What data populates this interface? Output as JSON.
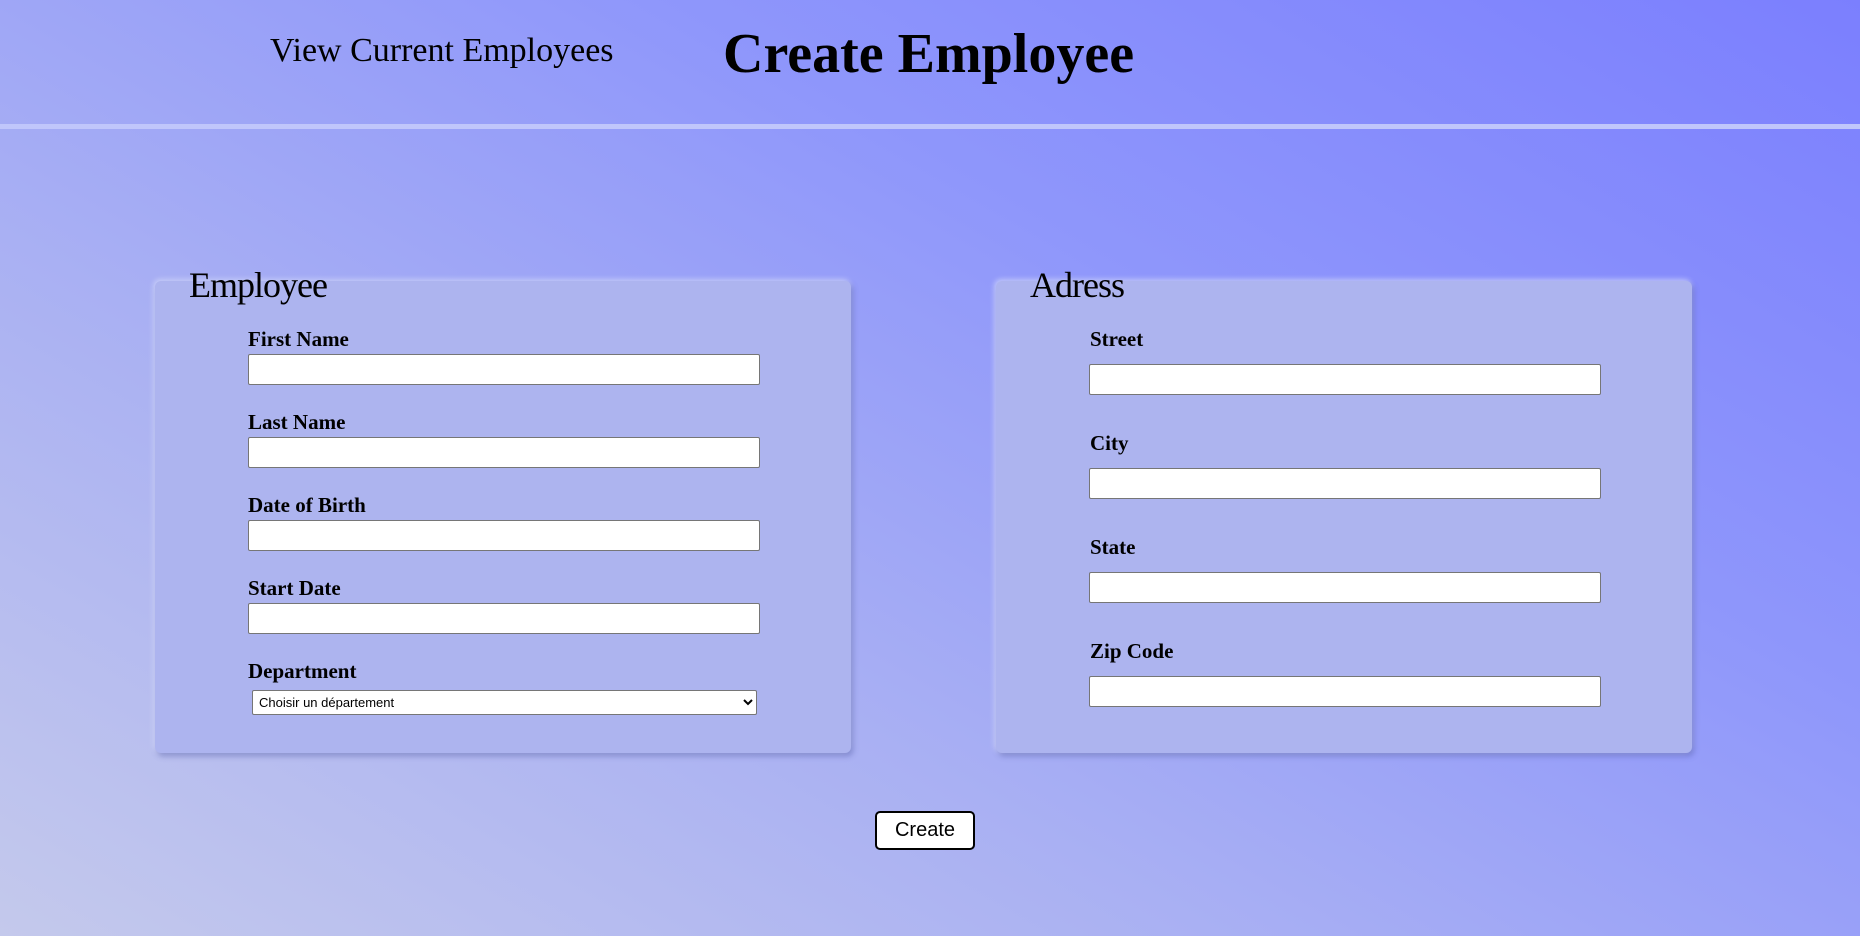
{
  "header": {
    "nav_link": "View Current Employees",
    "title": "Create Employee"
  },
  "employee": {
    "legend": "Employee",
    "fields": [
      {
        "label": "First Name",
        "value": ""
      },
      {
        "label": "Last Name",
        "value": ""
      },
      {
        "label": "Date of Birth",
        "value": ""
      },
      {
        "label": "Start Date",
        "value": ""
      }
    ],
    "department": {
      "label": "Department",
      "selected": "Choisir un département"
    }
  },
  "address": {
    "legend": "Adress",
    "fields": [
      {
        "label": "Street",
        "value": ""
      },
      {
        "label": "City",
        "value": ""
      },
      {
        "label": "State",
        "value": ""
      },
      {
        "label": "Zip Code",
        "value": ""
      }
    ]
  },
  "actions": {
    "create_label": "Create"
  }
}
